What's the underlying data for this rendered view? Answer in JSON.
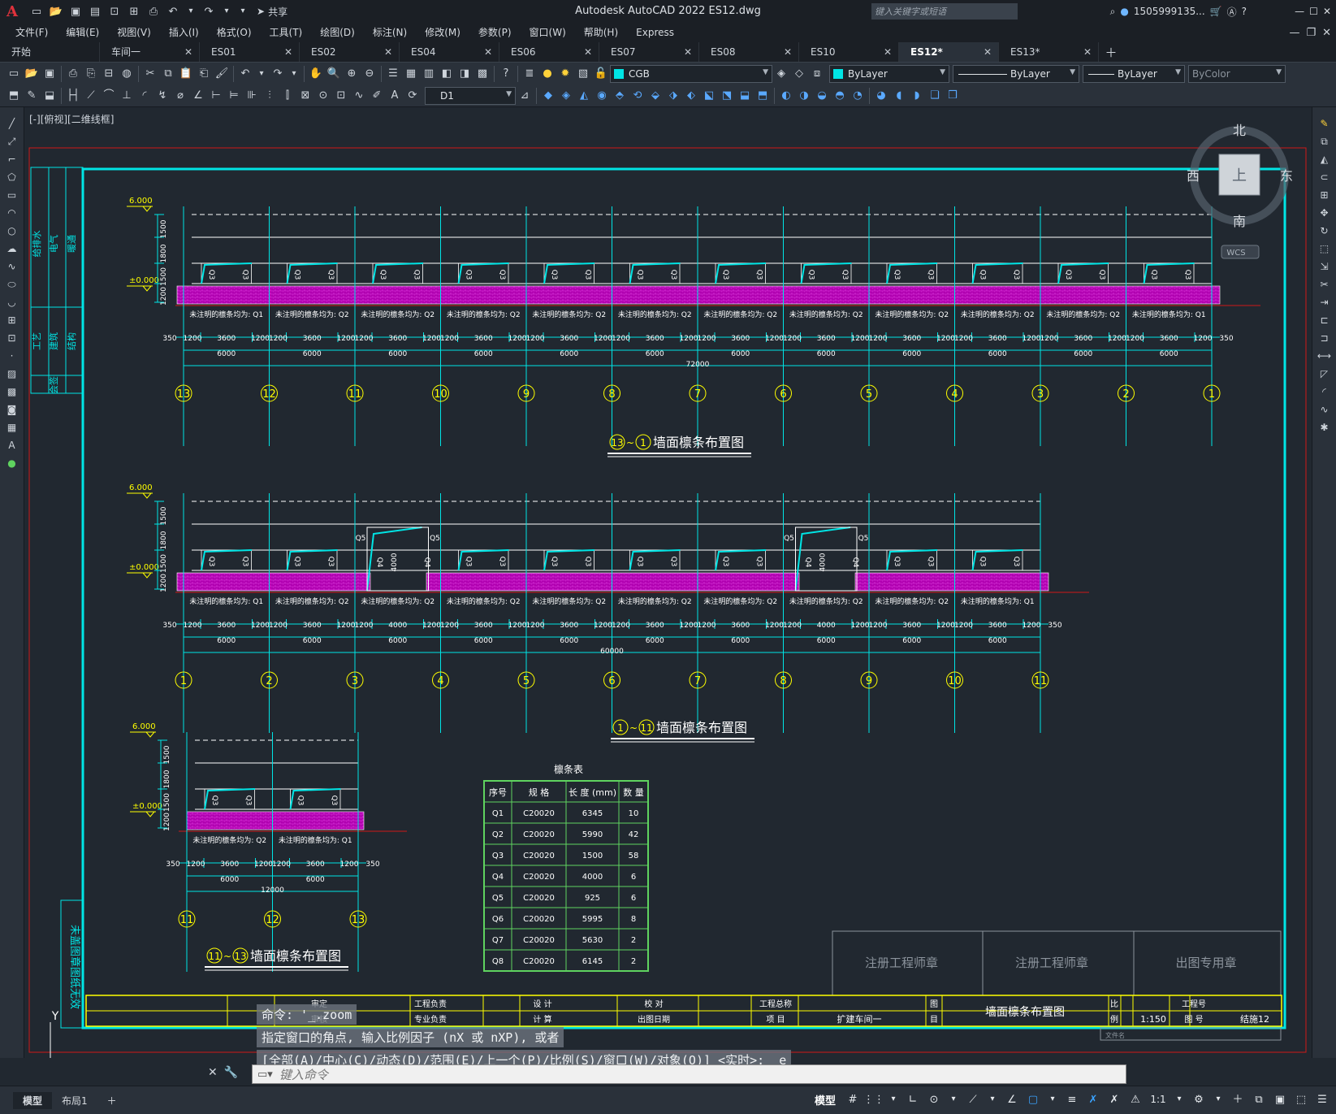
{
  "app": {
    "title": "Autodesk AutoCAD 2022    ES12.dwg",
    "logo": "A",
    "share": "共享",
    "search_placeholder": "键入关键字或短语",
    "user": "1505999135...",
    "cart_icon": "cart-icon",
    "help_icon": "help-icon"
  },
  "menu": [
    "文件(F)",
    "编辑(E)",
    "视图(V)",
    "插入(I)",
    "格式(O)",
    "工具(T)",
    "绘图(D)",
    "标注(N)",
    "修改(M)",
    "参数(P)",
    "窗口(W)",
    "帮助(H)",
    "Express"
  ],
  "tabs": [
    {
      "label": "开始",
      "active": false
    },
    {
      "label": "车间一",
      "active": false
    },
    {
      "label": "ES01",
      "active": false
    },
    {
      "label": "ES02",
      "active": false
    },
    {
      "label": "ES04",
      "active": false
    },
    {
      "label": "ES06",
      "active": false
    },
    {
      "label": "ES07",
      "active": false
    },
    {
      "label": "ES08",
      "active": false
    },
    {
      "label": "ES10",
      "active": false
    },
    {
      "label": "ES12*",
      "active": true
    },
    {
      "label": "ES13*",
      "active": false
    }
  ],
  "toolbar": {
    "layer": "CGB",
    "layer_color": "#00e5e5",
    "color": "ByLayer",
    "linetype": "ByLayer",
    "lineweight": "ByLayer",
    "plotstyle": "ByColor",
    "dimstyle": "D1"
  },
  "viewport": {
    "label": "[-][俯视][二维线框]",
    "viewcube": {
      "north": "北",
      "south": "南",
      "west": "西",
      "east": "东",
      "top": "上",
      "wcs": "WCS"
    }
  },
  "drawing": {
    "elev_top": "6.000",
    "elev_base": "±0.000",
    "vert_dims": [
      "1500",
      "1800",
      "1500",
      "1200"
    ],
    "note_q1": "未注明的檩条均为: Q1",
    "note_q2": "未注明的檩条均为: Q2",
    "purlin_q3": "Q3",
    "purlin_q4": "Q4",
    "purlin_q5": "Q5",
    "dim_4000": "4000",
    "dim_350": "350",
    "dim_1200": "1200",
    "dim_3600": "3600",
    "dim_6000": "6000",
    "view1": {
      "title": "墙面檩条布置图",
      "from": "13",
      "to": "1",
      "total": "72000",
      "axes": [
        "13",
        "12",
        "11",
        "10",
        "9",
        "8",
        "7",
        "6",
        "5",
        "4",
        "3",
        "2",
        "1"
      ]
    },
    "view2": {
      "title": "墙面檩条布置图",
      "from": "1",
      "to": "11",
      "total": "60000",
      "axes": [
        "1",
        "2",
        "3",
        "4",
        "5",
        "6",
        "7",
        "8",
        "9",
        "10",
        "11"
      ]
    },
    "view3": {
      "title": "墙面檩条布置图",
      "from": "11",
      "to": "13",
      "total": "12000",
      "axes": [
        "11",
        "12",
        "13"
      ]
    },
    "left_block": [
      "给排水",
      "电气",
      "暖通",
      "工艺",
      "建筑",
      "结构",
      "会签"
    ],
    "stamp_note": "未盖图章图纸无效",
    "purlin_table": {
      "title": "檩条表",
      "headers": [
        "序号",
        "规 格",
        "长 度 (mm)",
        "数 量"
      ],
      "rows": [
        [
          "Q1",
          "C20020",
          "6345",
          "10"
        ],
        [
          "Q2",
          "C20020",
          "5990",
          "42"
        ],
        [
          "Q3",
          "C20020",
          "1500",
          "58"
        ],
        [
          "Q4",
          "C20020",
          "4000",
          "6"
        ],
        [
          "Q5",
          "C20020",
          "925",
          "6"
        ],
        [
          "Q6",
          "C20020",
          "5995",
          "8"
        ],
        [
          "Q7",
          "C20020",
          "5630",
          "2"
        ],
        [
          "Q8",
          "C20020",
          "6145",
          "2"
        ]
      ]
    },
    "title_block": {
      "stamp1": "注册工程师章",
      "stamp2": "注册工程师章",
      "stamp3": "出图专用章",
      "shending": "审定",
      "shenhe": "审核",
      "gcfz": "工程负责",
      "zyfz": "专业负责",
      "sheji": "设 计",
      "jisuan": "计 算",
      "jiaodui": "校 对",
      "ctrq": "出图日期",
      "gczc": "工程总称",
      "xiangmu": "项 目",
      "project": "扩建车间一",
      "tu": "图",
      "mu": "目",
      "drawing_name": "墙面檩条布置图",
      "bi": "比",
      "li": "例",
      "scale": "1:150",
      "gch": "工程号",
      "th": "图 号",
      "sheet": "结施12",
      "file": "文件名"
    },
    "ucs": {
      "y": "Y",
      "x": "X"
    }
  },
  "command": {
    "history": [
      "命令: '_.zoom",
      "指定窗口的角点, 输入比例因子 (nX 或 nXP), 或者",
      "[全部(A)/中心(C)/动态(D)/范围(E)/上一个(P)/比例(S)/窗口(W)/对象(O)] <实时>: _e"
    ],
    "placeholder": "键入命令"
  },
  "status": {
    "layouts": [
      "模型",
      "布局1"
    ],
    "model": "模型",
    "scale": "1:1"
  }
}
